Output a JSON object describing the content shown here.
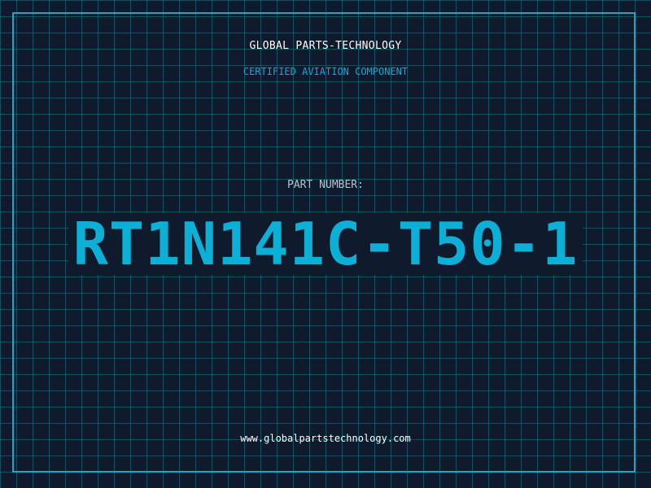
{
  "header": {
    "company_name": "GLOBAL PARTS-TECHNOLOGY",
    "subtitle": "CERTIFIED AVIATION COMPONENT"
  },
  "main": {
    "part_label": "PART NUMBER:",
    "part_number": "RT1N141C-T50-1"
  },
  "footer": {
    "website": "www.globalpartstechnology.com"
  },
  "colors": {
    "background": "#0f1a2c",
    "grid": "#16788c",
    "accent": "#0cb0d6",
    "frame": "#1aa7c9",
    "text_primary": "#ffffff",
    "text_secondary": "#b7c3d3"
  }
}
